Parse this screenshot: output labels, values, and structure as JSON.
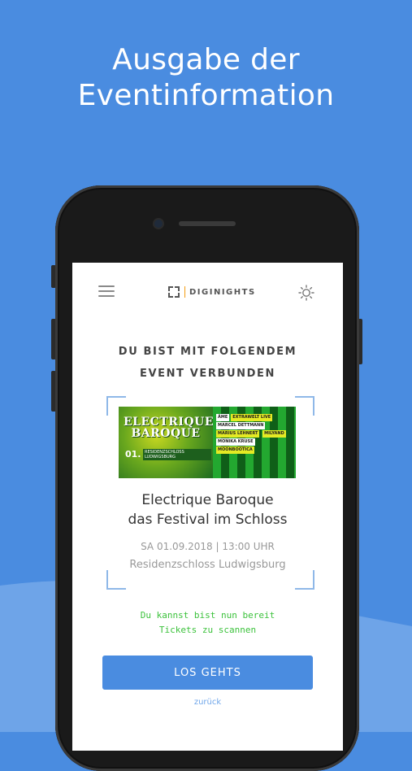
{
  "promo": {
    "headline_line1": "Ausgabe der",
    "headline_line2": "Eventinformation"
  },
  "colors": {
    "background": "#4a8ce0",
    "accent": "#4a8ce0",
    "success_text": "#3cc23c",
    "logo_separator": "#f39c12"
  },
  "app": {
    "header": {
      "menu_icon": "hamburger-menu-icon",
      "logo_text": "DIGINIGHTS",
      "theme_icon": "sun-icon"
    },
    "connected_line1": "DU BIST MIT FOLGENDEM",
    "connected_line2": "EVENT VERBUNDEN",
    "event": {
      "flyer": {
        "title_line1": "ELECTRIQUE",
        "title_line2": "BAROQUE",
        "date": "01.",
        "venue": "RESIDENZSCHLOSS LUDWIGSBURG",
        "lineup": [
          "ÂME",
          "EXTRAWELT LIVE",
          "MARCEL DETTMANN",
          "MARIUS LEHNERT",
          "MILYAND",
          "MONIKA KRUSE",
          "MOONBOOTICA"
        ]
      },
      "title_line1": "Electrique Baroque",
      "title_line2": "das Festival im Schloss",
      "date_time": "SA 01.09.2018  | 13:00 UHR",
      "venue": "Residenzschloss Ludwigsburg"
    },
    "ready_line1": "Du kannst bist nun bereit",
    "ready_line2": "Tickets zu scannen",
    "cta_label": "LOS GEHTS",
    "back_label": "zurück"
  }
}
